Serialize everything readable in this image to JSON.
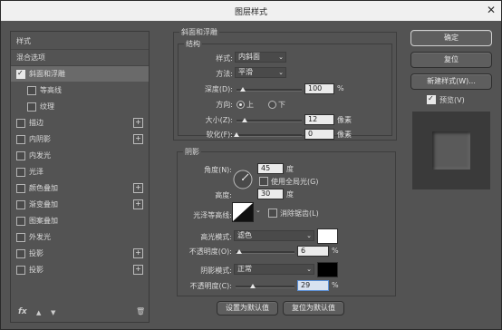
{
  "window": {
    "title": "图层样式",
    "close_glyph": "✕"
  },
  "sidebar": {
    "items": [
      {
        "label": "样式",
        "checkbox": false,
        "checked": false,
        "plus": false
      },
      {
        "label": "混合选项",
        "checkbox": false,
        "checked": false,
        "plus": false
      },
      {
        "label": "斜面和浮雕",
        "checkbox": true,
        "checked": true,
        "plus": false,
        "selected": true
      },
      {
        "label": "等高线",
        "checkbox": true,
        "checked": false,
        "plus": false
      },
      {
        "label": "纹理",
        "checkbox": true,
        "checked": false,
        "plus": false
      },
      {
        "label": "描边",
        "checkbox": true,
        "checked": false,
        "plus": true
      },
      {
        "label": "内阴影",
        "checkbox": true,
        "checked": false,
        "plus": true
      },
      {
        "label": "内发光",
        "checkbox": true,
        "checked": false,
        "plus": false
      },
      {
        "label": "光泽",
        "checkbox": true,
        "checked": false,
        "plus": false
      },
      {
        "label": "颜色叠加",
        "checkbox": true,
        "checked": false,
        "plus": true
      },
      {
        "label": "渐变叠加",
        "checkbox": true,
        "checked": false,
        "plus": true
      },
      {
        "label": "图案叠加",
        "checkbox": true,
        "checked": false,
        "plus": false
      },
      {
        "label": "外发光",
        "checkbox": true,
        "checked": false,
        "plus": false
      },
      {
        "label": "投影",
        "checkbox": true,
        "checked": false,
        "plus": true
      },
      {
        "label": "投影",
        "checkbox": true,
        "checked": false,
        "plus": true
      }
    ],
    "plus_glyph": "+",
    "footer": {
      "fx": "fx",
      "up": "▲",
      "down": "▼",
      "trash": "🗑"
    }
  },
  "bevel": {
    "title": "斜面和浮雕",
    "structure_title": "结构",
    "style_label": "样式:",
    "style_value": "内斜面",
    "technique_label": "方法:",
    "technique_value": "平滑",
    "depth_label": "深度(D):",
    "depth_value": "100",
    "depth_unit": "%",
    "depth_pct": 0.1,
    "direction_label": "方向:",
    "dir_up": "上",
    "dir_down": "下",
    "size_label": "大小(Z):",
    "size_value": "12",
    "size_unit": "像素",
    "size_pct": 0.12,
    "soften_label": "软化(F):",
    "soften_value": "0",
    "soften_unit": "像素",
    "soften_pct": 0.0
  },
  "shading": {
    "title": "阴影",
    "angle_label": "角度(N):",
    "angle_value": "45",
    "angle_unit": "度",
    "global_light_label": "使用全局光(G)",
    "altitude_label": "高度:",
    "altitude_value": "30",
    "altitude_unit": "度",
    "gloss_label": "光泽等高线:",
    "antialias_label": "消除锯齿(L)",
    "highlight_mode_label": "高光模式:",
    "highlight_mode_value": "滤色",
    "highlight_color": "#ffffff",
    "highlight_opacity_label": "不透明度(O):",
    "highlight_opacity_value": "6",
    "highlight_opacity_unit": "%",
    "highlight_pct": 0.06,
    "shadow_mode_label": "阴影模式:",
    "shadow_mode_value": "正常",
    "shadow_color": "#000000",
    "shadow_opacity_label": "不透明度(C):",
    "shadow_opacity_value": "29",
    "shadow_opacity_unit": "%",
    "shadow_pct": 0.29
  },
  "bottom_buttons": {
    "make_default": "设置为默认值",
    "reset_default": "复位为默认值"
  },
  "right": {
    "ok": "确定",
    "reset": "复位",
    "new_style": "新建样式(W)...",
    "preview_label": "预览(V)"
  },
  "dropdown_arrow": "⌄"
}
